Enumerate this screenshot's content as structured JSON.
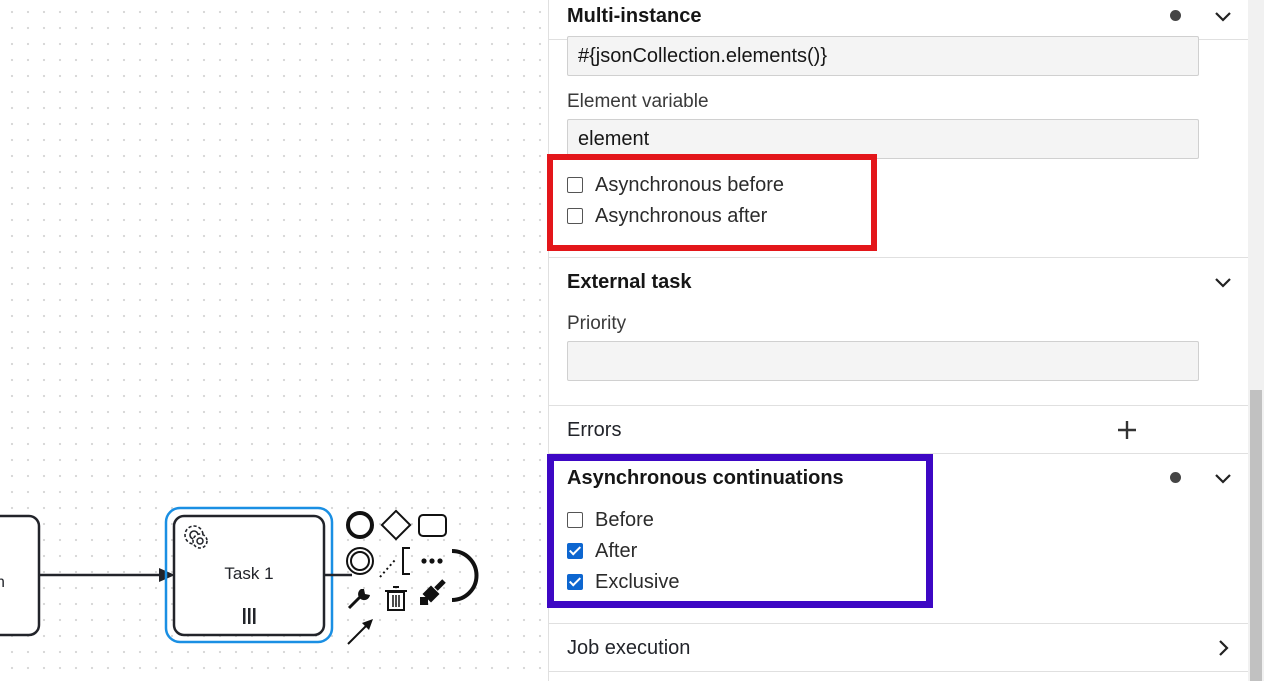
{
  "canvas": {
    "task_label": "Task 1",
    "left_task_label_fragment": "n"
  },
  "panel": {
    "multi_instance": {
      "title": "Multi-instance",
      "collection_value": "#{jsonCollection.elements()}",
      "element_variable_label": "Element variable",
      "element_variable_value": "element",
      "async_before_label": "Asynchronous before",
      "async_before_checked": false,
      "async_after_label": "Asynchronous after",
      "async_after_checked": false
    },
    "external_task": {
      "title": "External task",
      "priority_label": "Priority",
      "priority_value": ""
    },
    "errors": {
      "title": "Errors",
      "add_icon": "plus-icon"
    },
    "async_continuations": {
      "title": "Asynchronous continuations",
      "before_label": "Before",
      "before_checked": false,
      "after_label": "After",
      "after_checked": true,
      "exclusive_label": "Exclusive",
      "exclusive_checked": true
    },
    "job_execution": {
      "title": "Job execution"
    }
  },
  "colors": {
    "selection": "#1a8fe3",
    "highlight_red": "#e3161a",
    "highlight_blue": "#3d07c4",
    "checkbox_checked": "#0d66d0"
  }
}
